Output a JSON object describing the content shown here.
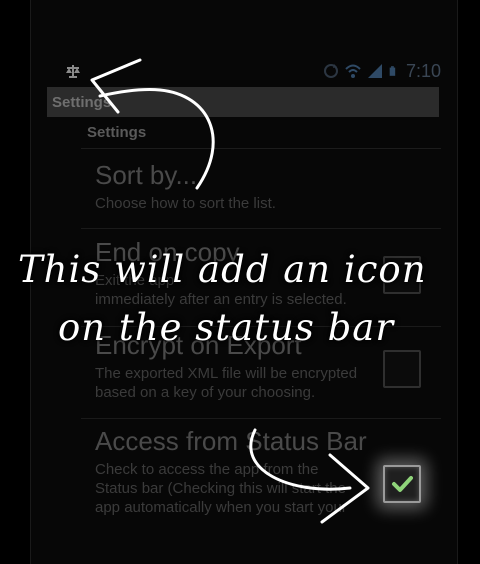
{
  "status_bar": {
    "time": "7:10",
    "left_icon": "app-scale-icon",
    "right_icons": [
      "sync-icon",
      "wifi-icon",
      "signal-icon",
      "battery-icon"
    ]
  },
  "action_bar": {
    "title": "Settings"
  },
  "category": {
    "label": "Settings"
  },
  "prefs": [
    {
      "title": "Sort by...",
      "summary_lines": [
        "Choose how to sort the list."
      ],
      "checkbox": null
    },
    {
      "title": "End on copy",
      "summary_lines": [
        "Exit the app",
        "immediately after an entry is selected."
      ],
      "checkbox": false
    },
    {
      "title": "Encrypt on Export",
      "summary_lines": [
        "The exported XML file will be encrypted",
        "based on a key of your choosing."
      ],
      "checkbox": false
    },
    {
      "title": "Access from Status Bar",
      "summary_lines": [
        "Check to access the app from the",
        "Status bar (Checking this will start the",
        "app automatically when you start your"
      ],
      "checkbox": true
    }
  ],
  "annotation": {
    "line1": "This will add an icon",
    "line2": "on the status bar",
    "color": "#ffffff"
  },
  "colors": {
    "accent": "#8fd47a",
    "background": "#070707",
    "action_bar": "#2b2b2b"
  }
}
